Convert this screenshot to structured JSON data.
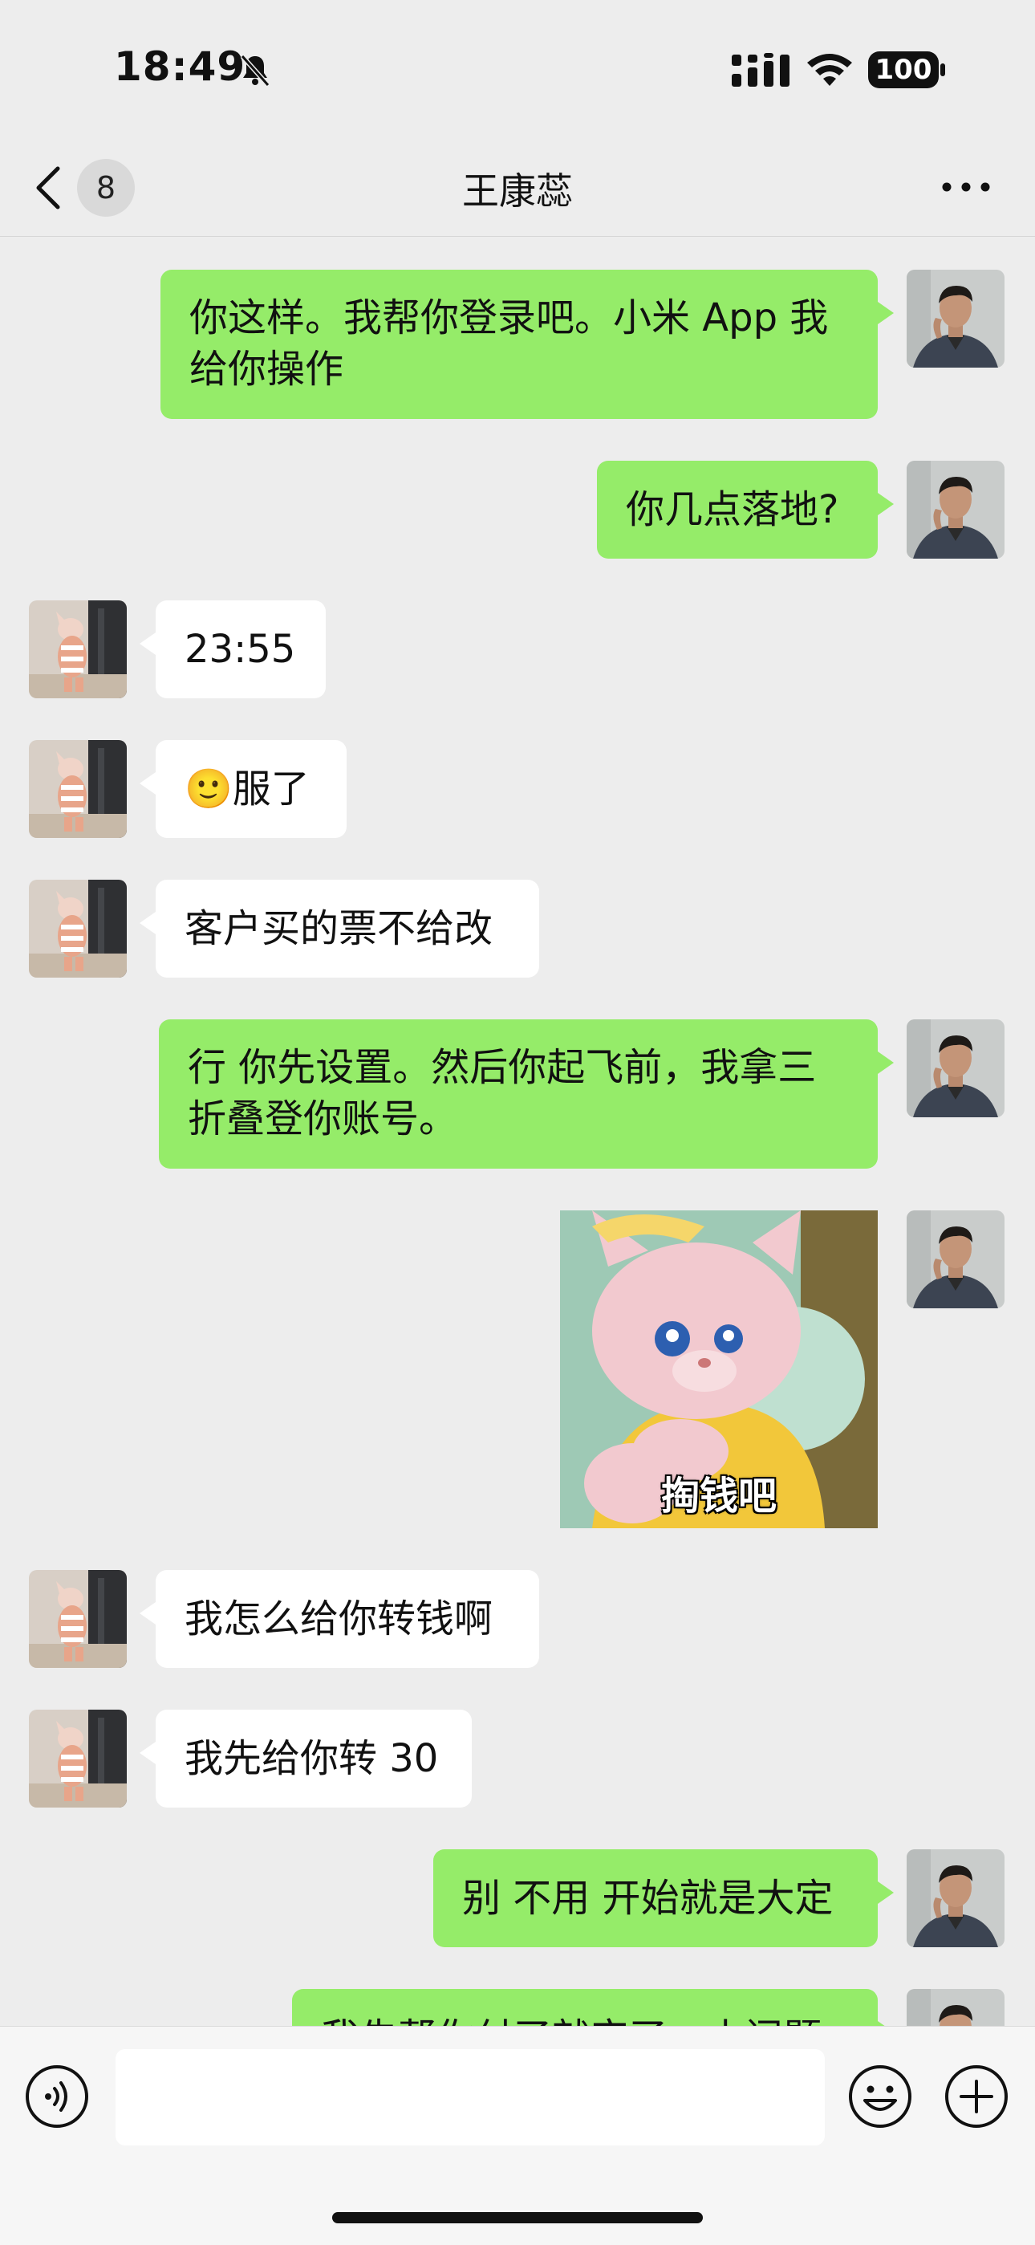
{
  "status_bar": {
    "time": "18:49",
    "battery": "100"
  },
  "header": {
    "title": "王康蕊",
    "unread_count": "8"
  },
  "messages": [
    {
      "text_lines": [
        "你这样。我帮你登录吧。小米 App 我",
        "给你操作"
      ]
    },
    {
      "text_lines": [
        "你几点落地?"
      ]
    },
    {
      "text_lines": [
        "23:55"
      ]
    },
    {
      "emoji": "🙂",
      "text_lines": [
        "服了"
      ]
    },
    {
      "text_lines": [
        "客户买的票不给改"
      ]
    },
    {
      "text_lines": [
        "行 你先设置。然后你起飞前，我拿三",
        "折叠登你账号。"
      ]
    },
    {
      "sticker_caption": "掏钱吧"
    },
    {
      "text_lines": [
        "我怎么给你转钱啊"
      ]
    },
    {
      "text_lines": [
        "我先给你转 30"
      ]
    },
    {
      "text_lines": [
        "别 不用 开始就是大定"
      ]
    },
    {
      "text_lines": [
        "我先帮你付了就完了，小问题"
      ]
    }
  ],
  "colors": {
    "outgoing_bubble": "#95ec69",
    "incoming_bubble": "#ffffff",
    "background": "#ededed"
  },
  "icons": {
    "back": "chevron-left-icon",
    "more": "ellipsis-icon",
    "voice": "voice-icon",
    "emoji": "smiley-icon",
    "plus": "plus-icon"
  }
}
